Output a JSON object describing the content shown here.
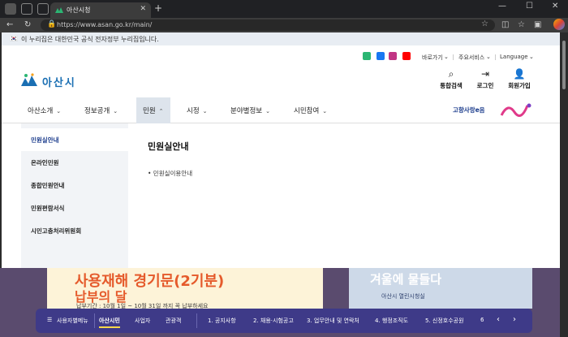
{
  "browser": {
    "tab_title": "아산시청",
    "url": "https://www.asan.go.kr/main/"
  },
  "gov_notice": "이 누리집은 대한민국 공식 전자정부 누리집입니다.",
  "logo_text": "아산시",
  "util_links": [
    "바로가기",
    "주요서비스",
    "Language"
  ],
  "quick_links": [
    {
      "label": "통합검색",
      "icon": "search-icon"
    },
    {
      "label": "로그인",
      "icon": "login-icon"
    },
    {
      "label": "회원가입",
      "icon": "user-plus-icon"
    }
  ],
  "gnb": [
    {
      "label": "아산소개"
    },
    {
      "label": "정보공개"
    },
    {
      "label": "민원",
      "active": true
    },
    {
      "label": "시정"
    },
    {
      "label": "분야별정보"
    },
    {
      "label": "시민참여"
    }
  ],
  "badges": {
    "hometown": "고향사랑e음"
  },
  "lnb": [
    {
      "label": "민원실안내",
      "active": true
    },
    {
      "label": "온라인민원"
    },
    {
      "label": "종합민원안내"
    },
    {
      "label": "민원편람서식"
    },
    {
      "label": "시민고충처리위원회"
    }
  ],
  "content": {
    "title": "민원실안내",
    "link": "• 민원실이용안내"
  },
  "banner": {
    "left_title": "사용재해 경기문(2기분)",
    "left_title2": "납부의 달",
    "left_sub": "납부기간 : 10월 1일 ~ 10월 31일 까지 꼭 납부하세요",
    "right_title": "겨울에 물들다",
    "right_sub": "아산시 열린시청실"
  },
  "footbar": {
    "menu_label": "사용자별메뉴",
    "tabs": [
      "아산시민",
      "사업자",
      "관광객"
    ],
    "items": [
      "1. 공지사항",
      "2. 채용·시험공고",
      "3. 업무안내 및 연락처",
      "4. 행정조직도",
      "5. 신정호수공원",
      "6"
    ]
  },
  "colors": {
    "accent": "#1b3c8c",
    "footbar": "#3e3a88",
    "active_tab": "#dde4ec"
  }
}
